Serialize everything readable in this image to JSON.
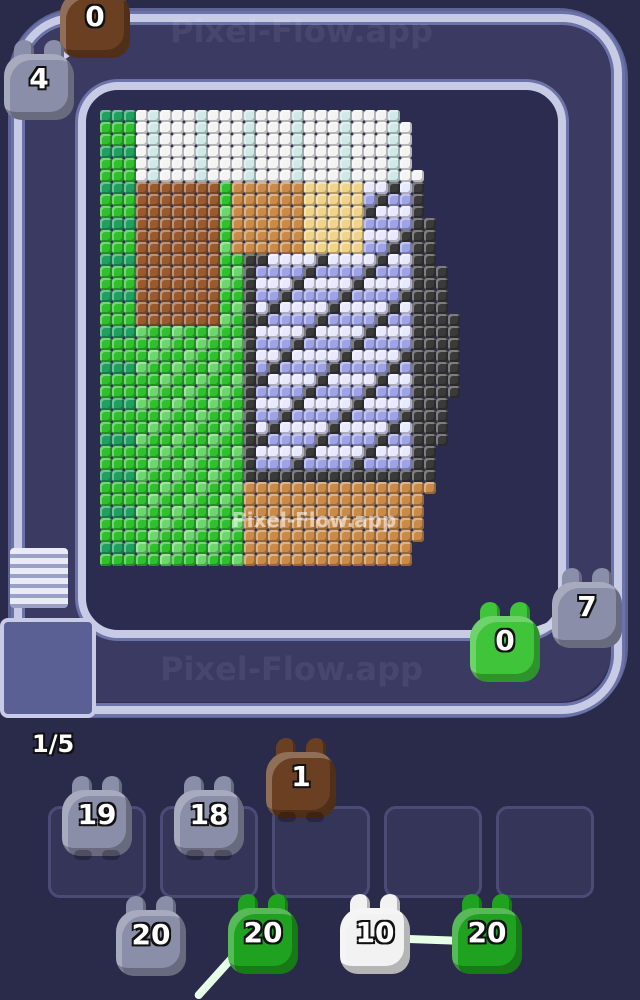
{
  "watermark": "Pixel-Flow.app",
  "watermark_track": "Pixel-Flow.app",
  "progress": "1/5",
  "colors": {
    "gray": "#8b8ea8",
    "green": "#3fc43a",
    "brown": "#6b3f22",
    "white": "#f2f2f2",
    "darkgreen": "#1fa21f"
  },
  "track_critters": [
    {
      "id": "top-left-brown",
      "value": "0",
      "color": "brown"
    },
    {
      "id": "top-left-gray",
      "value": "4",
      "color": "gray"
    },
    {
      "id": "right-green",
      "value": "0",
      "color": "green"
    },
    {
      "id": "right-gray",
      "value": "7",
      "color": "gray"
    }
  ],
  "queue": {
    "front": [
      {
        "value": "19",
        "color": "gray"
      },
      {
        "value": "18",
        "color": "gray"
      },
      {
        "value": "1",
        "color": "brown"
      }
    ],
    "back": [
      {
        "value": "20",
        "color": "gray"
      },
      {
        "value": "20",
        "color": "darkgreen"
      },
      {
        "value": "10",
        "color": "white"
      },
      {
        "value": "20",
        "color": "darkgreen"
      }
    ]
  }
}
